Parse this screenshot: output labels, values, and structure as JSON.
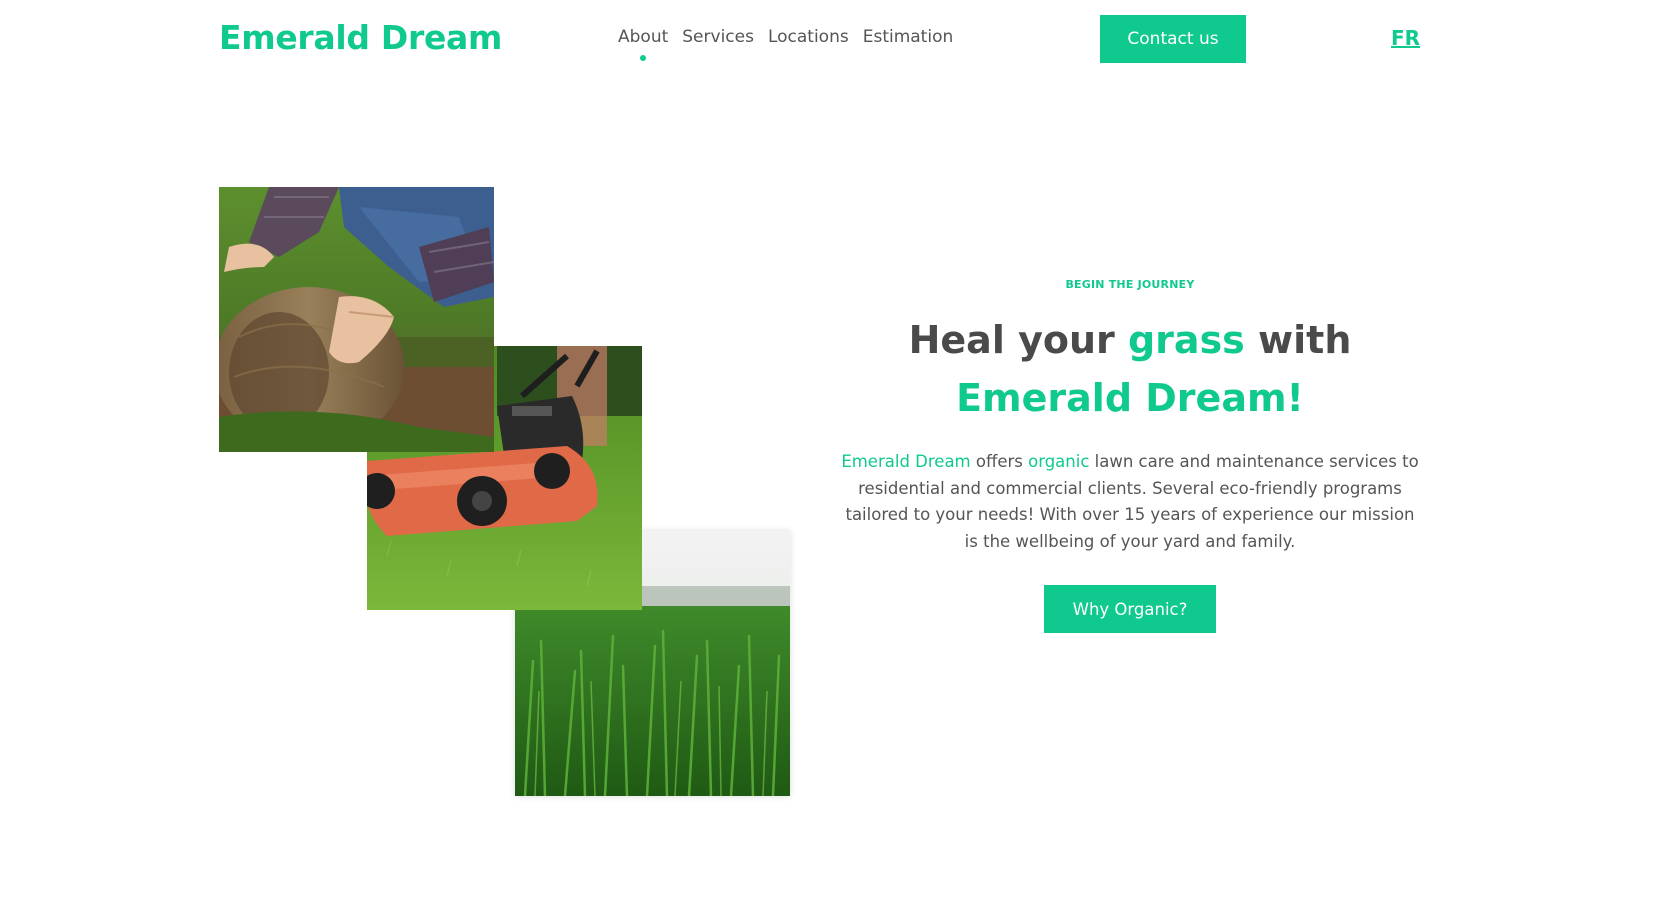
{
  "brand": {
    "name": "Emerald Dream",
    "accent_color": "#10c98f"
  },
  "nav": {
    "items": [
      {
        "label": "About",
        "active": true
      },
      {
        "label": "Services",
        "active": false
      },
      {
        "label": "Locations",
        "active": false
      },
      {
        "label": "Estimation",
        "active": false
      }
    ]
  },
  "header": {
    "contact_label": "Contact us",
    "language_label": "FR"
  },
  "hero": {
    "eyebrow": "BEGIN THE JOURNEY",
    "headline_part1": "Heal your ",
    "headline_highlight1": "grass",
    "headline_part2": " with",
    "headline_highlight2": "Emerald Dream!",
    "desc_brand": "Emerald Dream",
    "desc_part1": " offers ",
    "desc_highlight": "organic",
    "desc_part2": " lawn care and maintenance services to residential and commercial clients. Several eco-friendly programs tailored to your needs! With over 15 years of experience our mission is the wellbeing of your yard and family.",
    "cta_label": "Why Organic?"
  },
  "photos": [
    {
      "subject": "person-rolling-sod"
    },
    {
      "subject": "lawn-mower-on-grass"
    },
    {
      "subject": "close-up-grass-blades"
    }
  ]
}
